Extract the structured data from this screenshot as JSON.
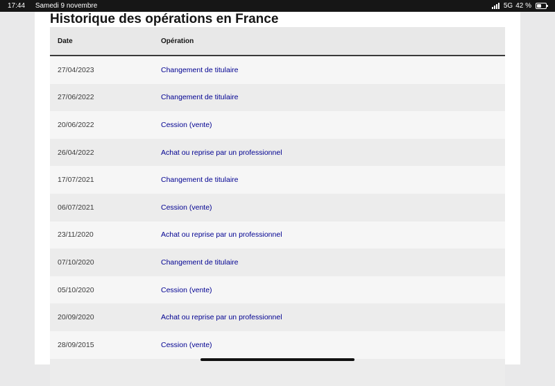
{
  "status_bar": {
    "time": "17:44",
    "date": "Samedi 9 novembre",
    "network": "5G",
    "battery": "42 %",
    "battery_level": 0.42
  },
  "page": {
    "title": "Historique des opérations en France"
  },
  "table": {
    "headers": {
      "date": "Date",
      "operation": "Opération"
    },
    "rows": [
      {
        "date": "27/04/2023",
        "operation": "Changement de titulaire"
      },
      {
        "date": "27/06/2022",
        "operation": "Changement de titulaire"
      },
      {
        "date": "20/06/2022",
        "operation": "Cession (vente)"
      },
      {
        "date": "26/04/2022",
        "operation": "Achat ou reprise par un professionnel"
      },
      {
        "date": "17/07/2021",
        "operation": "Changement de titulaire"
      },
      {
        "date": "06/07/2021",
        "operation": "Cession (vente)"
      },
      {
        "date": "23/11/2020",
        "operation": "Achat ou reprise par un professionnel"
      },
      {
        "date": "07/10/2020",
        "operation": "Changement de titulaire"
      },
      {
        "date": "05/10/2020",
        "operation": "Cession (vente)"
      },
      {
        "date": "20/09/2020",
        "operation": "Achat ou reprise par un professionnel"
      },
      {
        "date": "28/09/2015",
        "operation": "Cession (vente)"
      },
      {
        "date": "",
        "operation": ""
      }
    ]
  },
  "colors": {
    "link": "#000091",
    "header_bg": "#e8e8e8",
    "row_odd": "#f6f6f6",
    "row_even": "#ececec"
  }
}
